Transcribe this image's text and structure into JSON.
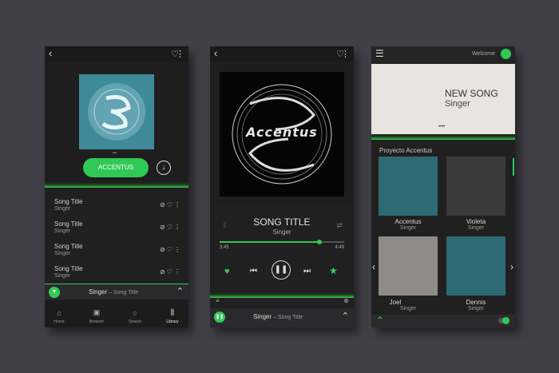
{
  "colors": {
    "accent": "#31c955",
    "background": "#414048",
    "phone": "#202020",
    "teal": "#2e6a74"
  },
  "screen1": {
    "album_button": "ACCENTUS",
    "songs": [
      {
        "title": "Song Title",
        "artist": "Singer"
      },
      {
        "title": "Song Title",
        "artist": "Singer"
      },
      {
        "title": "Song Title",
        "artist": "Singer"
      },
      {
        "title": "Song Title",
        "artist": "Singer"
      }
    ],
    "now_playing": {
      "artist": "Singer",
      "separator": " – ",
      "song": "Song Title"
    },
    "nav": [
      {
        "label": "Home",
        "icon": "home-icon"
      },
      {
        "label": "Browser",
        "icon": "browse-icon"
      },
      {
        "label": "Search",
        "icon": "search-icon"
      },
      {
        "label": "Library",
        "icon": "library-icon"
      }
    ]
  },
  "screen2": {
    "album_art_text": "Accentus",
    "song_title": "SONG TITLE",
    "artist": "Singer",
    "time_elapsed": "3:45",
    "time_total": "4:49",
    "progress": 0.8,
    "now_playing": {
      "artist": "Singer",
      "separator": " – ",
      "song": "Song Title"
    }
  },
  "screen3": {
    "welcome": "Welcome",
    "banner_title": "NEW SONG",
    "banner_subtitle": "Singer",
    "section_title": "Proyecto Accentus",
    "tiles": [
      {
        "name": "Accentus",
        "sub": "Singer",
        "color": "#2e6a74"
      },
      {
        "name": "Violeta",
        "sub": "Singer",
        "color": "#3a3a3a"
      },
      {
        "name": "Joel",
        "sub": "Singer",
        "color": "#8f8b88"
      },
      {
        "name": "Dennis",
        "sub": "Singer",
        "color": "#2e6a74"
      }
    ]
  }
}
